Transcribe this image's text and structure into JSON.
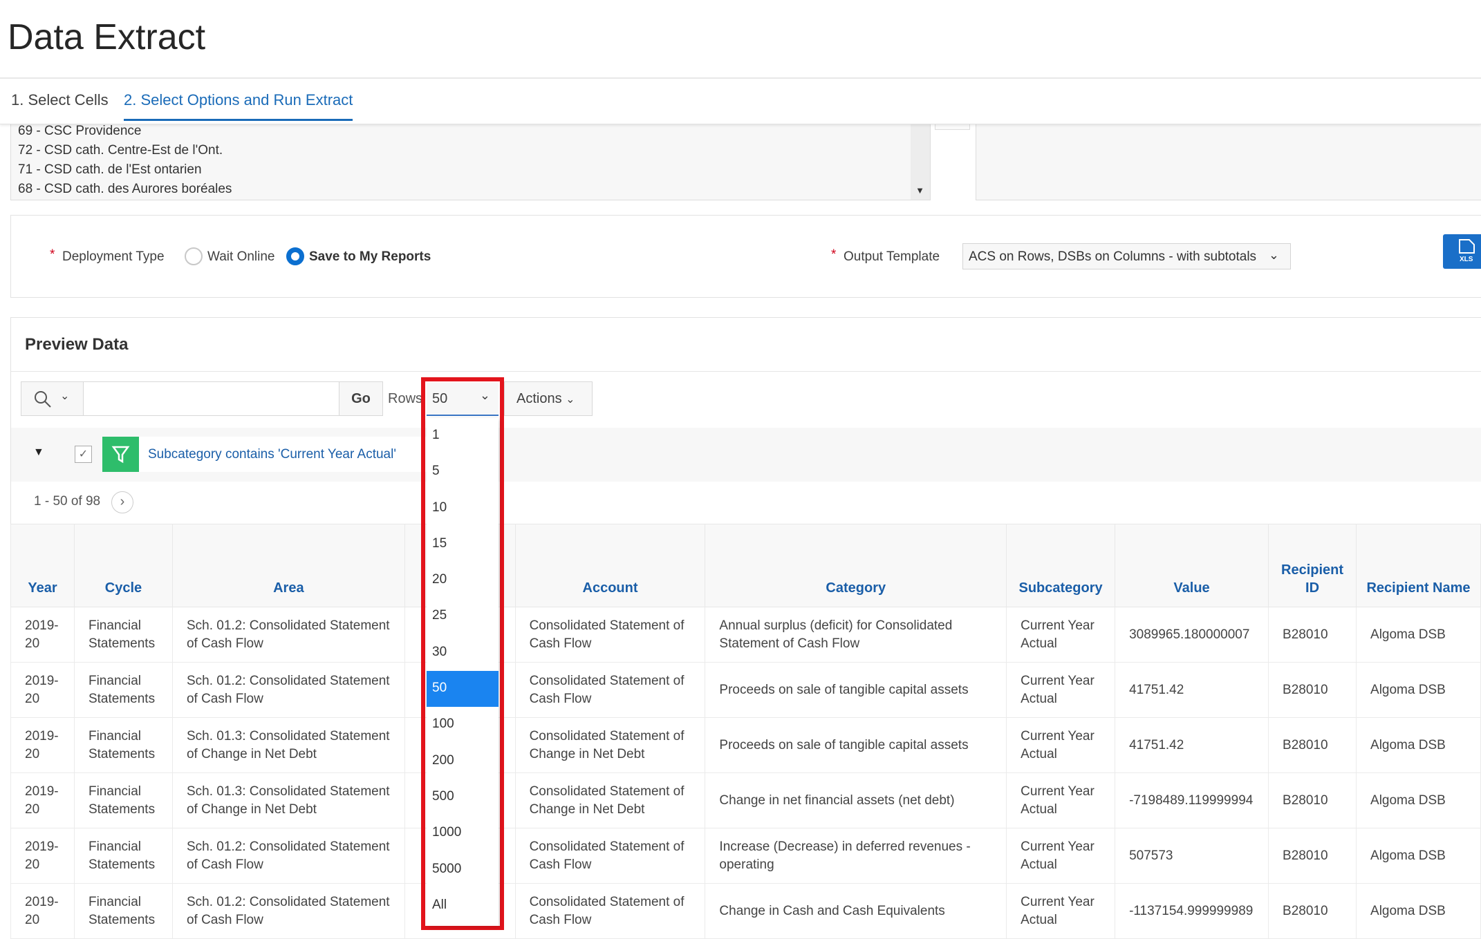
{
  "page": {
    "title": "Data Extract"
  },
  "tabs": [
    {
      "label": "1. Select Cells",
      "active": false
    },
    {
      "label": "2. Select Options and Run Extract",
      "active": true
    }
  ],
  "recipients_list": {
    "items": [
      "69 - CSC Providence",
      "72 - CSD cath. Centre-Est de l'Ont.",
      "71 - CSD cath. de l'Est ontarien",
      "68 - CSD cath. des Aurores boréales"
    ]
  },
  "options": {
    "required_marker": "*",
    "deployment_type_label": "Deployment Type",
    "deployment_options": [
      {
        "label": "Wait Online",
        "selected": false
      },
      {
        "label": "Save to My Reports",
        "selected": true
      }
    ],
    "output_template_label": "Output Template",
    "output_template_value": "ACS on Rows, DSBs on Columns - with subtotals",
    "xls_button_label": "XLS"
  },
  "preview": {
    "title": "Preview Data",
    "search_placeholder": "",
    "go_label": "Go",
    "rows_label": "Rows",
    "rows_value": "50",
    "actions_label": "Actions",
    "filter_text": "Subcategory contains 'Current Year Actual'",
    "filter_enabled": true,
    "pagination": "1 - 50 of 98",
    "rows_options": [
      "1",
      "5",
      "10",
      "15",
      "20",
      "25",
      "30",
      "50",
      "100",
      "200",
      "500",
      "1000",
      "5000",
      "All"
    ],
    "accent_color": "#1a84f0",
    "highlight_color": "#e3141c",
    "filter_color": "#2ebd6b"
  },
  "table": {
    "headers": [
      "Year",
      "Cycle",
      "Area",
      "",
      "Account",
      "Category",
      "Subcategory",
      "Value",
      "Recipient ID",
      "Recipient Name"
    ],
    "rows": [
      [
        "2019-20",
        "Financial Statements",
        "Sch. 01.2: Consolidated Statement of Cash Flow",
        "",
        "Consolidated Statement of Cash Flow",
        "Annual surplus (deficit) for Consolidated Statement of Cash Flow",
        "Current Year Actual",
        "3089965.180000007",
        "B28010",
        "Algoma DSB"
      ],
      [
        "2019-20",
        "Financial Statements",
        "Sch. 01.2: Consolidated Statement of Cash Flow",
        "",
        "Consolidated Statement of Cash Flow",
        "Proceeds on sale of tangible capital assets",
        "Current Year Actual",
        "41751.42",
        "B28010",
        "Algoma DSB"
      ],
      [
        "2019-20",
        "Financial Statements",
        "Sch. 01.3: Consolidated Statement of Change in Net Debt",
        "",
        "Consolidated Statement of Change in Net Debt",
        "Proceeds on sale of tangible capital assets",
        "Current Year Actual",
        "41751.42",
        "B28010",
        "Algoma DSB"
      ],
      [
        "2019-20",
        "Financial Statements",
        "Sch. 01.3: Consolidated Statement of Change in Net Debt",
        "",
        "Consolidated Statement of Change in Net Debt",
        "Change in net financial assets (net debt)",
        "Current Year Actual",
        "-7198489.119999994",
        "B28010",
        "Algoma DSB"
      ],
      [
        "2019-20",
        "Financial Statements",
        "Sch. 01.2: Consolidated Statement of Cash Flow",
        "",
        "Consolidated Statement of Cash Flow",
        "Increase (Decrease) in deferred revenues - operating",
        "Current Year Actual",
        "507573",
        "B28010",
        "Algoma DSB"
      ],
      [
        "2019-20",
        "Financial Statements",
        "Sch. 01.2: Consolidated Statement of Cash Flow",
        "",
        "Consolidated Statement of Cash Flow",
        "Change in Cash and Cash Equivalents",
        "Current Year Actual",
        "-1137154.999999989",
        "B28010",
        "Algoma DSB"
      ]
    ]
  }
}
